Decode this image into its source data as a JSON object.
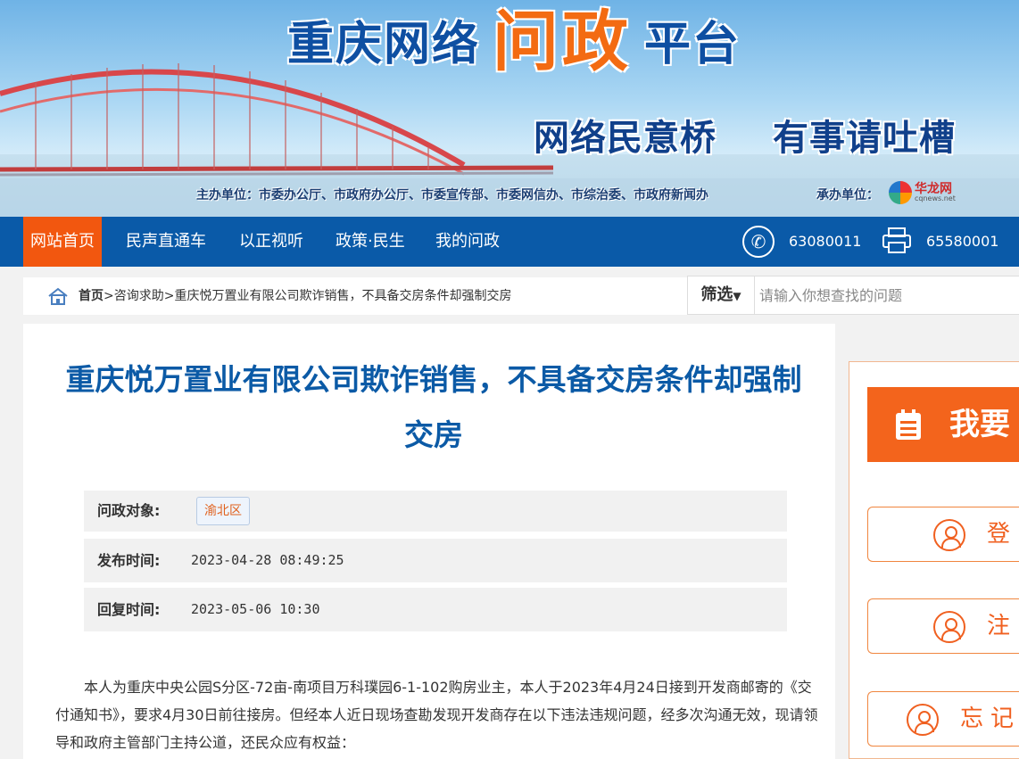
{
  "banner": {
    "title_part1": "重庆网络",
    "title_part2": "问政",
    "title_part3": "平台",
    "slogan_left": "网络民意桥",
    "slogan_right": "有事请吐槽",
    "sponsor": "主办单位：市委办公厅、市政府办公厅、市委宣传部、市委网信办、市综治委、市政府新闻办",
    "undertaker": "承办单位：",
    "logo_name": "华龙网",
    "logo_domain": "cqnews.net"
  },
  "nav": {
    "items": [
      "网站首页",
      "民声直通车",
      "以正视听",
      "政策·民生",
      "我的问政"
    ],
    "phone": "63080011",
    "fax": "65580001"
  },
  "breadcrumb": {
    "home": "首页",
    "rest": ">咨询求助>重庆悦万置业有限公司欺诈销售，不具备交房条件却强制交房"
  },
  "filter": {
    "label": "筛选",
    "arrow": "▼",
    "placeholder": "请输入你想查找的问题"
  },
  "article": {
    "title": "重庆悦万置业有限公司欺诈销售，不具备交房条件却强制交房",
    "target_label": "问政对象:",
    "target_value": "渝北区",
    "publish_label": "发布时间:",
    "publish_value": "2023-04-28 08:49:25",
    "reply_label": "回复时间:",
    "reply_value": "2023-05-06 10:30",
    "body": "本人为重庆中央公园S分区-72亩-南项目万科璞园6-1-102购房业主，本人于2023年4月24日接到开发商邮寄的《交付通知书》，要求4月30日前往接房。但经本人近日现场查勘发现开发商存在以下违法违规问题，经多次沟通无效，现请领导和政府主管部门主持公道，还民众应有权益："
  },
  "side": {
    "ask_label": "我要",
    "login_label": "登录",
    "register_label": "注册",
    "forgot_label": "忘记密"
  },
  "colors": {
    "nav_bg": "#0a5aa8",
    "accent_orange": "#f2570f",
    "title_blue": "#0b5aa6"
  }
}
